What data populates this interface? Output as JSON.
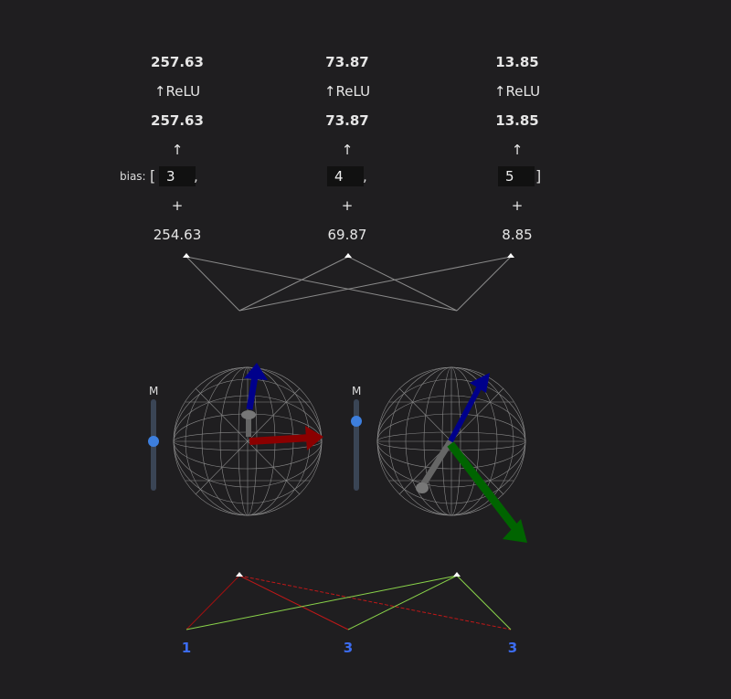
{
  "columns": [
    {
      "relu_out": "257.63",
      "relu_label": "↑ReLU",
      "pre": "257.63",
      "arrow": "↑",
      "bias": "3",
      "plus": "+",
      "input": "254.63"
    },
    {
      "relu_out": "73.87",
      "relu_label": "↑ReLU",
      "pre": "73.87",
      "arrow": "↑",
      "bias": "4",
      "plus": "+",
      "input": "69.87"
    },
    {
      "relu_out": "13.85",
      "relu_label": "↑ReLU",
      "pre": "13.85",
      "arrow": "↑",
      "bias": "5",
      "plus": "+",
      "input": "8.85"
    }
  ],
  "bias": {
    "label": "bias:",
    "open": "[",
    "close": "]",
    "sep": ","
  },
  "sliders": [
    {
      "label": "M",
      "level": 0.45
    },
    {
      "label": "M",
      "level": 0.22
    }
  ],
  "outputs": [
    "1",
    "3",
    "3"
  ],
  "colors": {
    "accent": "#3d7fde",
    "red": "#8b0000",
    "green": "#006400",
    "blue": "#00008b",
    "output": "#3c6cf0"
  }
}
